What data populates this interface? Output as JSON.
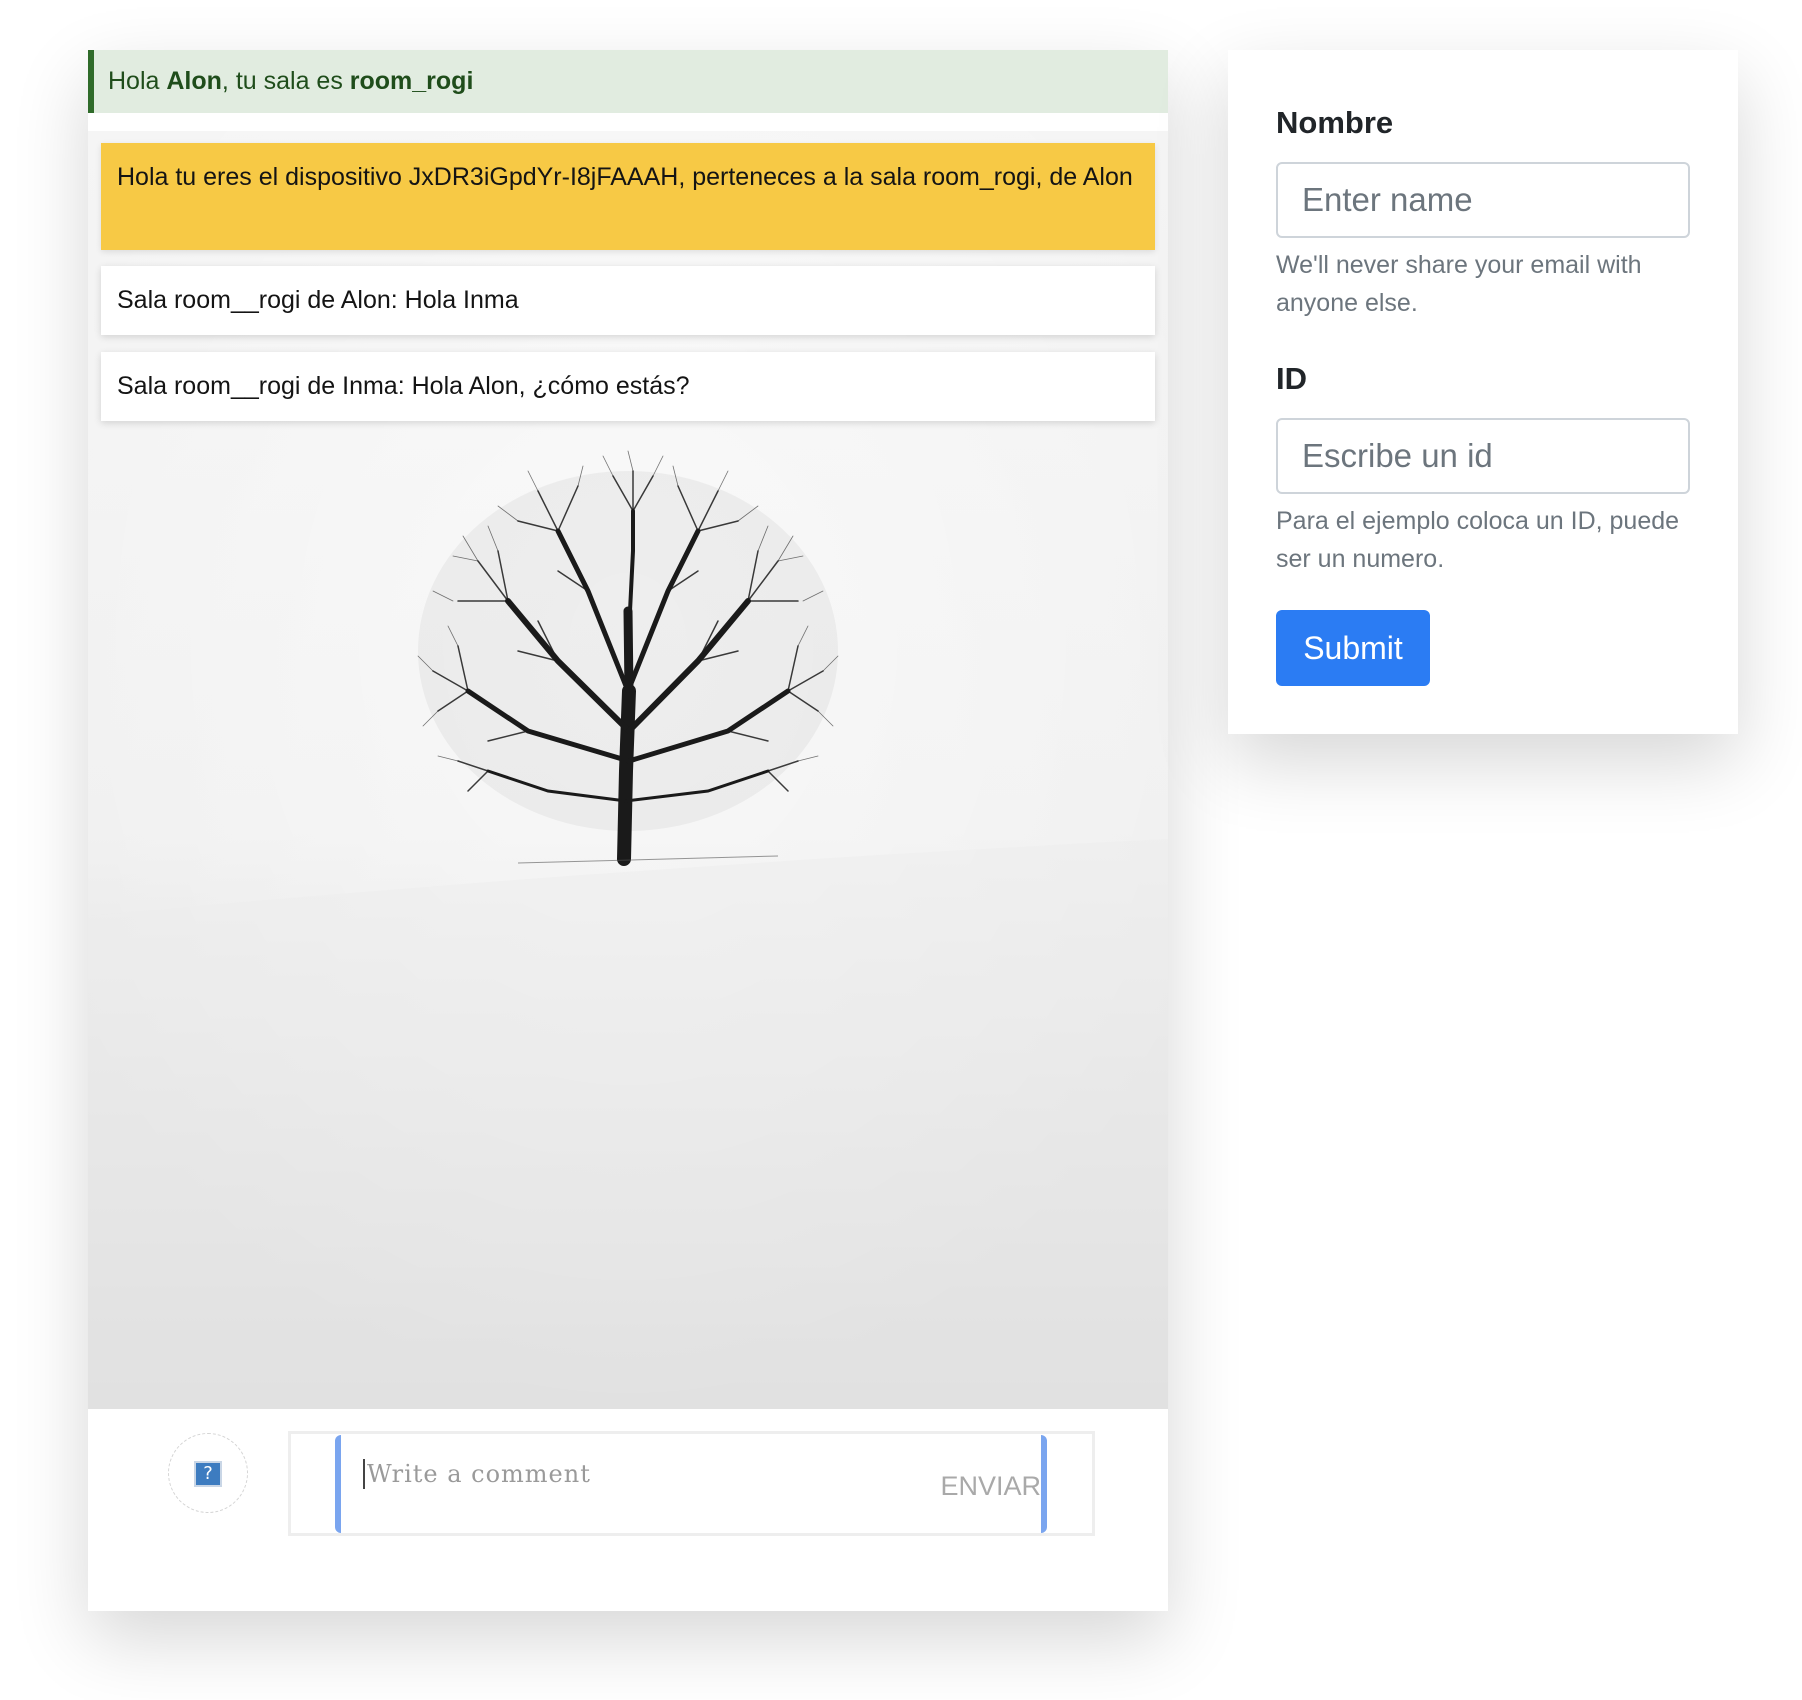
{
  "header": {
    "greeting_prefix": "Hola ",
    "user_name": "Alon",
    "greeting_middle": ", tu sala es ",
    "room_name": "room_rogi"
  },
  "chat": {
    "system_message": "Hola tu eres el dispositivo JxDR3iGpdYr-I8jFAAAH, perteneces a la sala room_rogi, de Alon",
    "messages": [
      "Sala room__rogi de Alon: Hola Inma",
      "Sala room__rogi de Inma: Hola Alon, ¿cómo estás?"
    ],
    "broken_image_glyph": "?"
  },
  "composer": {
    "placeholder": "Write a comment",
    "send_label": "ENVIAR"
  },
  "form": {
    "name_label": "Nombre",
    "name_placeholder": "Enter name",
    "name_help": "We'll never share your email with anyone else.",
    "id_label": "ID",
    "id_placeholder": "Escribe un id",
    "id_help": "Para el ejemplo coloca un ID, puede ser un numero.",
    "submit_label": "Submit"
  },
  "colors": {
    "welcome_bg": "#e1ece0",
    "welcome_border": "#2f6b2a",
    "system_message_bg": "#f7c945",
    "primary": "#2b7cf3",
    "composer_accent": "#7aa5ef"
  },
  "icons": {
    "avatar": "broken-image-icon"
  }
}
